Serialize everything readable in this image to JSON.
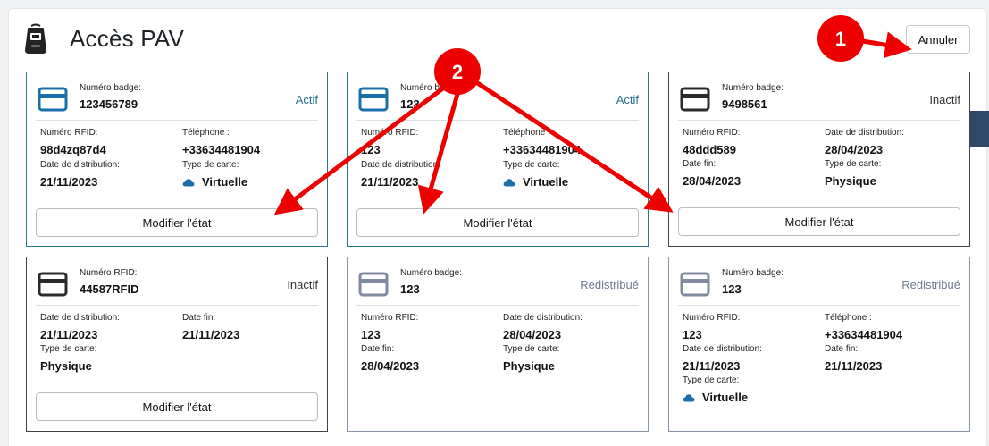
{
  "header": {
    "title": "Accès PAV",
    "cancel_label": "Annuler"
  },
  "labels": {
    "badge_number": "Numéro badge:",
    "rfid_number": "Numéro RFID:",
    "phone": "Téléphone :",
    "distribution_date": "Date de distribution:",
    "end_date": "Date fin:",
    "card_type": "Type de carte:",
    "modify_state": "Modifier l'état"
  },
  "cards": [
    {
      "badge": "123456789",
      "status": "Actif",
      "rfid": "98d4zq87d4",
      "phone": "+33634481904",
      "distribution": "21/11/2023",
      "type": "Virtuelle"
    },
    {
      "badge": "123",
      "status": "Actif",
      "rfid": "123",
      "phone": "+33634481904",
      "distribution": "21/11/2023",
      "type": "Virtuelle"
    },
    {
      "badge": "9498561",
      "status": "Inactif",
      "rfid": "48ddd589",
      "distribution": "28/04/2023",
      "end": "28/04/2023",
      "type": "Physique"
    },
    {
      "rfid": "44587RFID",
      "status": "Inactif",
      "distribution": "21/11/2023",
      "end": "21/11/2023",
      "type": "Physique"
    },
    {
      "badge": "123",
      "status": "Redistribué",
      "rfid": "123",
      "distribution": "28/04/2023",
      "end": "28/04/2023",
      "type": "Physique"
    },
    {
      "badge": "123",
      "status": "Redistribué",
      "rfid": "123",
      "phone": "+33634481904",
      "distribution": "21/11/2023",
      "end": "21/11/2023",
      "type": "Virtuelle"
    }
  ],
  "annotations": {
    "marker_1": "1",
    "marker_2": "2"
  },
  "colors": {
    "actif": "#2a6f93",
    "inactif": "#333333",
    "redistribue": "#6f7b8e",
    "annotation_red": "#ee0000"
  },
  "icons": [
    "pav-terminal-icon",
    "credit-card-icon",
    "cloud-icon"
  ]
}
